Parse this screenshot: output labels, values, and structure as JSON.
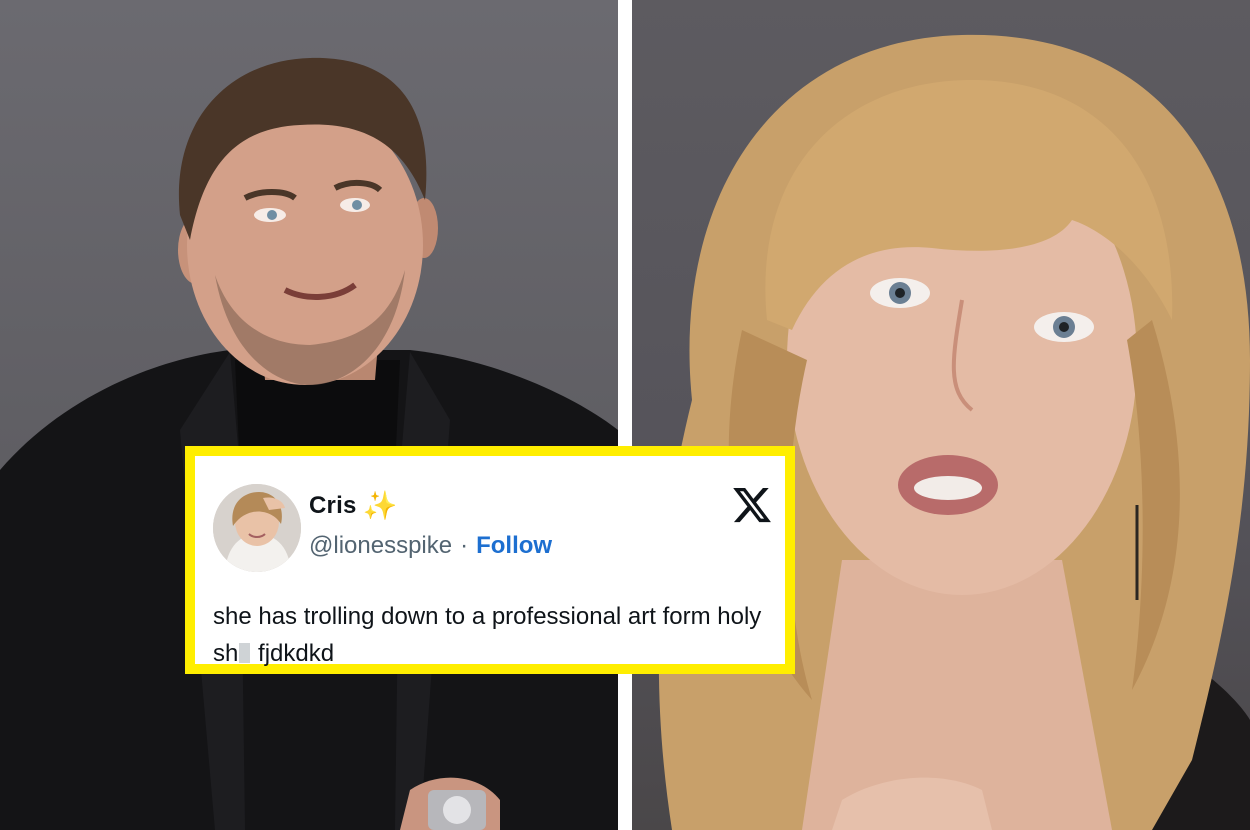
{
  "tweet": {
    "display_name": "Cris",
    "name_emoji": "✨",
    "handle": "@lionesspike",
    "separator": "·",
    "follow_label": "Follow",
    "text_part1": "she has trolling down to a professional art form holy sh",
    "text_part2": " fjdkdkd",
    "platform_icon": "x-logo-icon"
  },
  "colors": {
    "card_border": "#ffee00",
    "follow_link": "#1d6fd0",
    "handle_gray": "#536471",
    "divider": "#ffffff"
  }
}
